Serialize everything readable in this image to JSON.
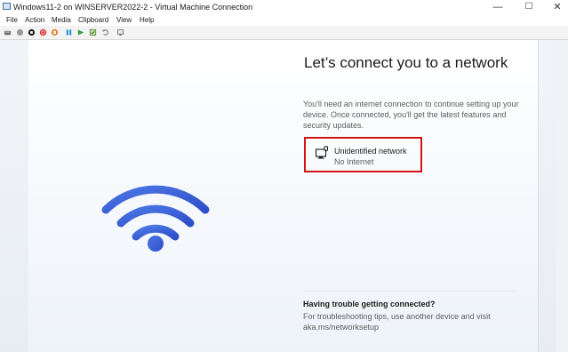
{
  "window": {
    "title": "Windows11-2 on WINSERVER2022-2 - Virtual Machine Connection",
    "minimize_glyph": "—",
    "maximize_glyph": "☐",
    "close_glyph": "✕"
  },
  "menu": {
    "items": [
      {
        "label": "File"
      },
      {
        "label": "Action"
      },
      {
        "label": "Media"
      },
      {
        "label": "Clipboard"
      },
      {
        "label": "View"
      },
      {
        "label": "Help"
      }
    ]
  },
  "toolbar": {
    "buttons": [
      {
        "icon": "ctrl-alt-del-icon",
        "color": "#6b6b6b"
      },
      {
        "icon": "start-icon",
        "color": "#9a9a9a"
      },
      {
        "icon": "turn-off-icon",
        "color": "#1a1a1a"
      },
      {
        "icon": "shut-down-icon",
        "color": "#d11515"
      },
      {
        "icon": "save-icon",
        "color": "#e37b1b"
      },
      {
        "icon": "pause-icon",
        "color": "#1d8fd6"
      },
      {
        "icon": "resume-icon",
        "color": "#2e9e3a"
      },
      {
        "icon": "checkpoint-icon",
        "color": "#5a8a3a"
      },
      {
        "icon": "revert-icon",
        "color": "#7a7a7a"
      },
      {
        "icon": "enhanced-session-icon",
        "color": "#7a7a7a"
      }
    ]
  },
  "setup": {
    "heading": "Let’s connect you to a network",
    "description": "You'll need an internet connection to continue setting up your device. Once connected, you'll get the latest features and security updates.",
    "network": {
      "name": "Unidentified network",
      "status": "No Internet",
      "highlight_color": "#d11515"
    },
    "trouble_title": "Having trouble getting connected?",
    "trouble_text": "For troubleshooting tips, use another device and visit aka.ms/networksetup",
    "wifi_color": "#3f63d6"
  }
}
